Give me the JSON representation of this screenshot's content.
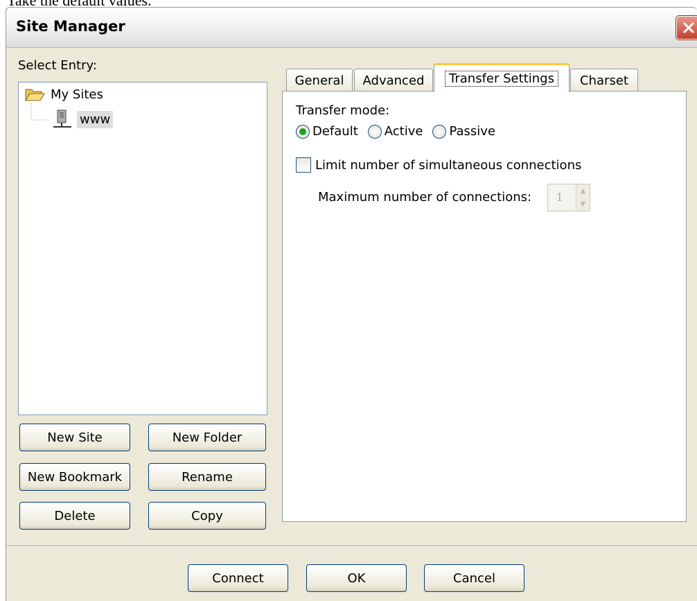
{
  "caption": "Take the default values.",
  "window": {
    "title": "Site Manager"
  },
  "left": {
    "select_entry_label": "Select Entry:",
    "tree": [
      {
        "label": "My Sites",
        "icon": "folder-open-icon"
      },
      {
        "label": "www",
        "icon": "server-icon",
        "selected": true
      }
    ],
    "buttons": {
      "new_site": "New Site",
      "new_folder": "New Folder",
      "new_bookmark": "New Bookmark",
      "rename": "Rename",
      "delete": "Delete",
      "copy": "Copy"
    }
  },
  "tabs": [
    "General",
    "Advanced",
    "Transfer Settings",
    "Charset"
  ],
  "active_tab": "Transfer Settings",
  "transfer": {
    "mode_label": "Transfer mode:",
    "modes": [
      "Default",
      "Active",
      "Passive"
    ],
    "selected_mode": "Default",
    "limit_label": "Limit number of simultaneous connections",
    "limit_checked": false,
    "max_label": "Maximum number of connections:",
    "max_value": "1"
  },
  "footer": {
    "connect": "Connect",
    "ok": "OK",
    "cancel": "Cancel"
  },
  "colors": {
    "radio_selected": "#21a121",
    "close_button": "#c3412a",
    "active_tab_accent": "#ffc83c"
  }
}
